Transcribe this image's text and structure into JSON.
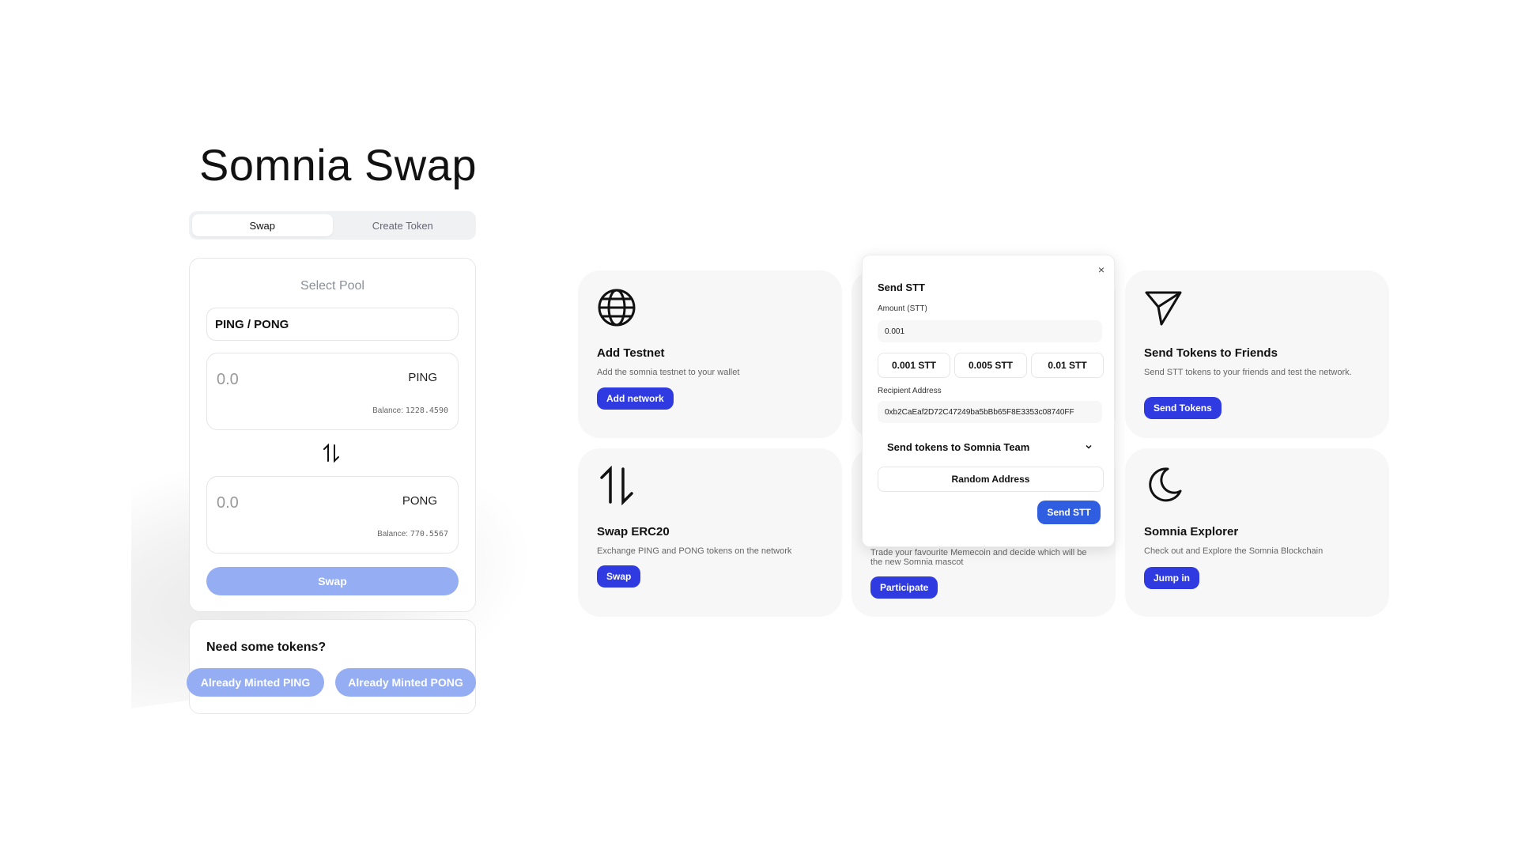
{
  "app": {
    "title": "Somnia Swap"
  },
  "tabs": [
    {
      "label": "Swap",
      "active": true
    },
    {
      "label": "Create Token",
      "active": false
    }
  ],
  "swap_card": {
    "select_label": "Select Pool",
    "pool": "PING / PONG",
    "from": {
      "amount": "0.0",
      "symbol": "PING",
      "balance_label": "Balance:",
      "balance": "1228.4590"
    },
    "to": {
      "amount": "0.0",
      "symbol": "PONG",
      "balance_label": "Balance:",
      "balance": "770.5567"
    },
    "swap_button": "Swap"
  },
  "need_card": {
    "title": "Need some tokens?",
    "ping_button": "Already Minted PING",
    "pong_button": "Already Minted PONG"
  },
  "features": {
    "add_testnet": {
      "title": "Add Testnet",
      "desc": "Add the somnia testnet to your wallet",
      "button": "Add network",
      "icon": "globe-icon"
    },
    "swap_erc20": {
      "title": "Swap ERC20",
      "desc": "Exchange PING and PONG tokens on the network",
      "button": "Swap",
      "icon": "swap-arrows-icon"
    },
    "send_friends": {
      "title": "Send Tokens to Friends",
      "desc": "Send STT tokens to your friends and test the network.",
      "button": "Send Tokens",
      "icon": "send-icon"
    },
    "explorer": {
      "title": "Somnia Explorer",
      "desc": "Check out and Explore the Somnia Blockchain",
      "button": "Jump in",
      "icon": "moon-icon"
    },
    "memecoin": {
      "desc": "Trade your favourite Memecoin and decide which will be the new Somnia mascot",
      "button": "Participate"
    }
  },
  "modal": {
    "close": "×",
    "title": "Send STT",
    "amount_label": "Amount (STT)",
    "amount_value": "0.001",
    "presets": [
      "0.001 STT",
      "0.005 STT",
      "0.01 STT"
    ],
    "recipient_label": "Recipient Address",
    "recipient_value": "0xb2CaEaf2D72C47249ba5bBb65F8E3353c08740FF",
    "dropdown": "Send tokens to Somnia Team",
    "random_button": "Random Address",
    "send_button": "Send STT"
  },
  "colors": {
    "primary": "#2f3be0",
    "disabled": "#94adf3",
    "card_bg": "#f7f7f7"
  }
}
